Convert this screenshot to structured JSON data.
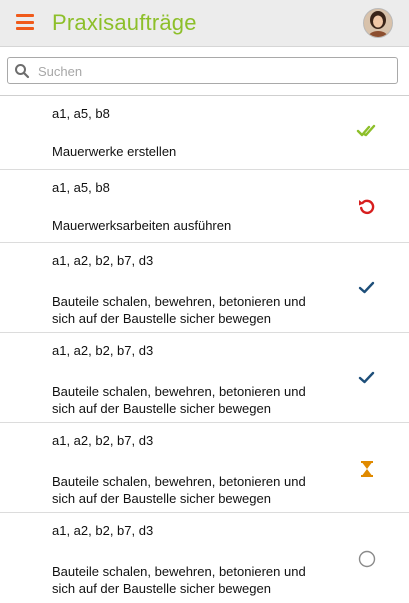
{
  "header": {
    "title": "Praxisaufträge",
    "menu_icon": "hamburger-menu-icon",
    "avatar_icon": "user-avatar",
    "accent_color": "#8dbf2a",
    "menu_color": "#f05a1a"
  },
  "search": {
    "placeholder": "Suchen",
    "icon": "search-icon"
  },
  "items": [
    {
      "codes": "a1, a5, b8",
      "title": "Mauerwerke erstellen",
      "status": "double-check-icon",
      "status_color": "#8dbf2a"
    },
    {
      "codes": "a1, a5, b8",
      "title": "Mauerwerksarbeiten ausführen",
      "status": "redo-icon",
      "status_color": "#d71e1e"
    },
    {
      "codes": "a1, a2, b2, b7, d3",
      "title": "Bauteile schalen, bewehren, betonieren und sich auf der Baustelle sicher bewegen",
      "status": "check-icon",
      "status_color": "#1e4f7a"
    },
    {
      "codes": "a1, a2, b2, b7, d3",
      "title": "Bauteile schalen, bewehren, betonieren und sich auf der Baustelle sicher bewegen",
      "status": "check-icon",
      "status_color": "#1e4f7a"
    },
    {
      "codes": "a1, a2, b2, b7, d3",
      "title": "Bauteile schalen, bewehren, betonieren und sich auf der Baustelle sicher bewegen",
      "status": "hourglass-icon",
      "status_color": "#e08a00"
    },
    {
      "codes": "a1, a2, b2, b7, d3",
      "title": "Bauteile schalen, bewehren, betonieren und sich auf der Baustelle sicher bewegen",
      "status": "empty-circle-icon",
      "status_color": "#8a8a8a"
    }
  ]
}
